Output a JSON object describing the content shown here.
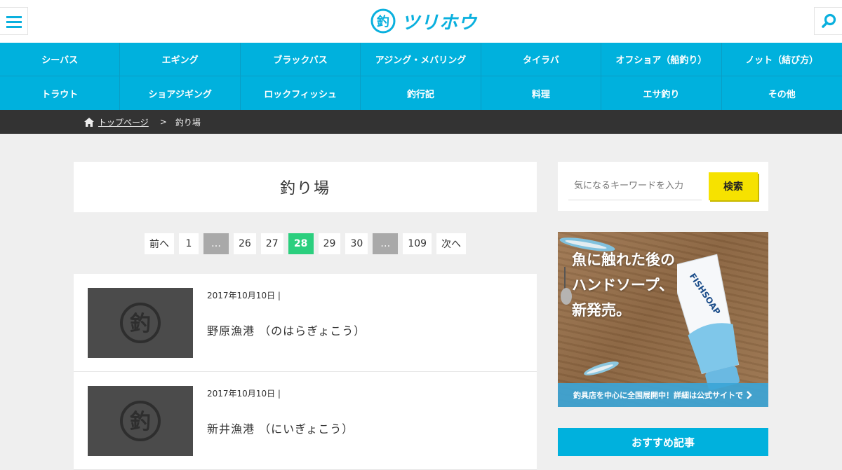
{
  "site": {
    "logo_text": "ツリホウ",
    "logo_mark": "釣"
  },
  "nav": {
    "items": [
      "シーバス",
      "エギング",
      "ブラックバス",
      "アジング・メバリング",
      "タイラバ",
      "オフショア（船釣り）",
      "ノット（結び方）",
      "トラウト",
      "ショアジギング",
      "ロックフィッシュ",
      "釣行記",
      "料理",
      "エサ釣り",
      "その他"
    ]
  },
  "breadcrumb": {
    "home": "トップページ",
    "separator": ">",
    "current": "釣り場"
  },
  "page": {
    "title": "釣り場"
  },
  "pagination": {
    "prev": "前へ",
    "first": "1",
    "dots": "…",
    "pages": [
      "26",
      "27",
      "28",
      "29",
      "30"
    ],
    "current": "28",
    "last": "109",
    "next": "次へ"
  },
  "posts": [
    {
      "date": "2017年10月10日 |",
      "title": "野原漁港 （のはらぎょこう）",
      "thumb_mark": "釣"
    },
    {
      "date": "2017年10月10日 |",
      "title": "新井漁港 （にいぎょこう）",
      "thumb_mark": "釣"
    }
  ],
  "search": {
    "placeholder": "気になるキーワードを入力",
    "button": "検索"
  },
  "ad": {
    "line1": "魚に触れた後の",
    "line2": "ハンドソープ、",
    "line3": "新発売。",
    "product": "FISHSOAP",
    "footer": "釣具店を中心に全国展開中！詳細は公式サイトで"
  },
  "sidebar": {
    "recommend_title": "おすすめ記事"
  },
  "colors": {
    "brand": "#00b1dd",
    "current_page": "#2bcf7e",
    "search_button": "#f6e200"
  },
  "icons": {
    "menu": "hamburger-icon",
    "search": "magnifier-icon",
    "home": "home-icon",
    "chevron": "chevron-right-icon"
  }
}
